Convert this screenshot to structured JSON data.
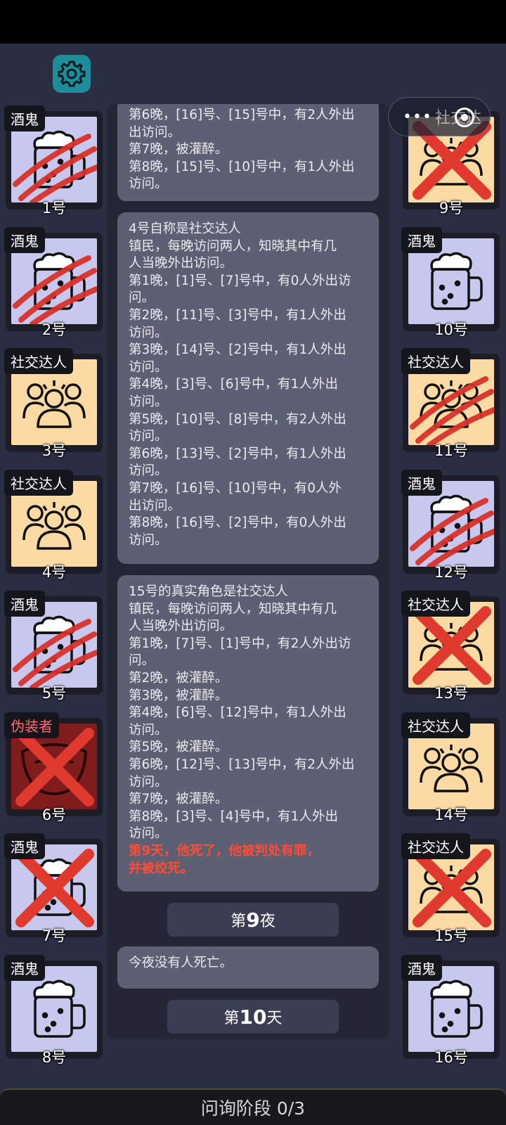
{
  "capsule": {
    "dots": "•••",
    "label": "社交达"
  },
  "players_left": [
    {
      "role": "酒鬼",
      "num": "1号",
      "type": "drunk",
      "state": "claw"
    },
    {
      "role": "酒鬼",
      "num": "2号",
      "type": "drunk",
      "state": "claw"
    },
    {
      "role": "社交达人",
      "num": "3号",
      "type": "social",
      "state": "alive"
    },
    {
      "role": "社交达人",
      "num": "4号",
      "type": "social",
      "state": "alive"
    },
    {
      "role": "酒鬼",
      "num": "5号",
      "type": "drunk",
      "state": "claw"
    },
    {
      "role": "伪装者",
      "num": "6号",
      "type": "disguise",
      "state": "x"
    },
    {
      "role": "酒鬼",
      "num": "7号",
      "type": "drunk",
      "state": "x"
    },
    {
      "role": "酒鬼",
      "num": "8号",
      "type": "drunk",
      "state": "alive"
    }
  ],
  "players_right": [
    {
      "role": "",
      "num": "9号",
      "type": "social",
      "state": "x"
    },
    {
      "role": "酒鬼",
      "num": "10号",
      "type": "drunk",
      "state": "alive"
    },
    {
      "role": "社交达人",
      "num": "11号",
      "type": "social",
      "state": "claw"
    },
    {
      "role": "酒鬼",
      "num": "12号",
      "type": "drunk",
      "state": "claw"
    },
    {
      "role": "社交达人",
      "num": "13号",
      "type": "social",
      "state": "x"
    },
    {
      "role": "社交达人",
      "num": "14号",
      "type": "social",
      "state": "alive"
    },
    {
      "role": "社交达人",
      "num": "15号",
      "type": "social",
      "state": "x"
    },
    {
      "role": "酒鬼",
      "num": "16号",
      "type": "drunk",
      "state": "alive"
    }
  ],
  "log": {
    "msg1": [
      "第6晚，[16]号、[15]号中，有2人外出",
      "出访问。",
      "第7晚，被灌醉。",
      "第8晚，[15]号、[10]号中，有1人外出",
      "访问。"
    ],
    "msg2": [
      "4号自称是社交达人",
      "镇民，每晚访问两人，知晓其中有几",
      "人当晚外出访问。",
      "第1晚，[1]号、[7]号中，有0人外出访",
      "问。",
      "第2晚，[11]号、[3]号中，有1人外出",
      "访问。",
      "第3晚，[14]号、[2]号中，有1人外出",
      "访问。",
      "第4晚，[3]号、[6]号中，有1人外出",
      "访问。",
      "第5晚，[10]号、[8]号中，有2人外出",
      "访问。",
      "第6晚，[13]号、[2]号中，有1人外出",
      "访问。",
      "第7晚，[16]号、[10]号中，有0人外",
      "出访问。",
      "第8晚，[16]号、[2]号中，有0人外出",
      "访问。"
    ],
    "msg3": [
      "15号的真实角色是社交达人",
      "镇民，每晚访问两人，知晓其中有几",
      "人当晚外出访问。",
      "第1晚，[7]号、[1]号中，有2人外出访",
      "问。",
      "第2晚，被灌醉。",
      "第3晚，被灌醉。",
      "第4晚，[6]号、[12]号中，有1人外出",
      "访问。",
      "第5晚，被灌醉。",
      "第6晚，[12]号、[13]号中，有2人外出",
      "访问。",
      "第7晚，被灌醉。",
      "第8晚，[3]号、[4]号中，有1人外出",
      "访问。"
    ],
    "msg3_death": [
      "第9天，他死了，他被判处有罪，",
      "并被绞死。"
    ],
    "night9": {
      "pre": "第",
      "num": "9",
      "post": "夜"
    },
    "msg4": "今夜没有人死亡。",
    "day10": {
      "pre": "第",
      "num": "10",
      "post": "天"
    }
  },
  "bottom": {
    "phase": "问询阶段 0/3"
  },
  "colors": {
    "drunk_bg": "#c8c8ee",
    "social_bg": "#fbdba3",
    "disguise_bg": "#7f1c1c",
    "claw": "#d8322a",
    "death_text": "#ff4c36",
    "settings": "#1e8d9a"
  }
}
